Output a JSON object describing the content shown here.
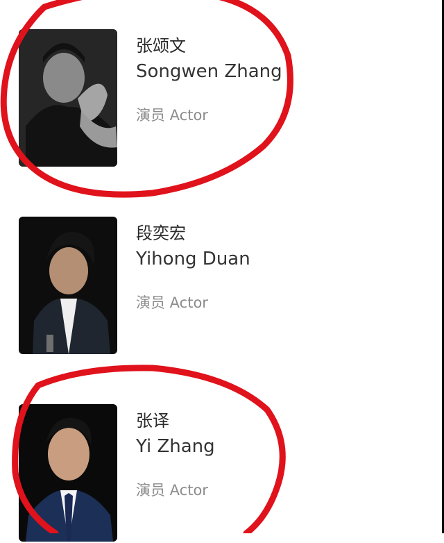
{
  "cast": [
    {
      "name_cn": "张颂文",
      "name_en": "Songwen Zhang",
      "role": "演员 Actor",
      "circled": true
    },
    {
      "name_cn": "段奕宏",
      "name_en": "Yihong Duan",
      "role": "演员 Actor",
      "circled": false
    },
    {
      "name_cn": "张译",
      "name_en": "Yi Zhang",
      "role": "演员 Actor",
      "circled": true
    }
  ],
  "colors": {
    "circle": "#e0121b",
    "role_text": "#8c8c8c",
    "name_text": "#2a2a2a"
  },
  "icons": [
    "portrait-photo-1",
    "portrait-photo-2",
    "portrait-photo-3"
  ]
}
